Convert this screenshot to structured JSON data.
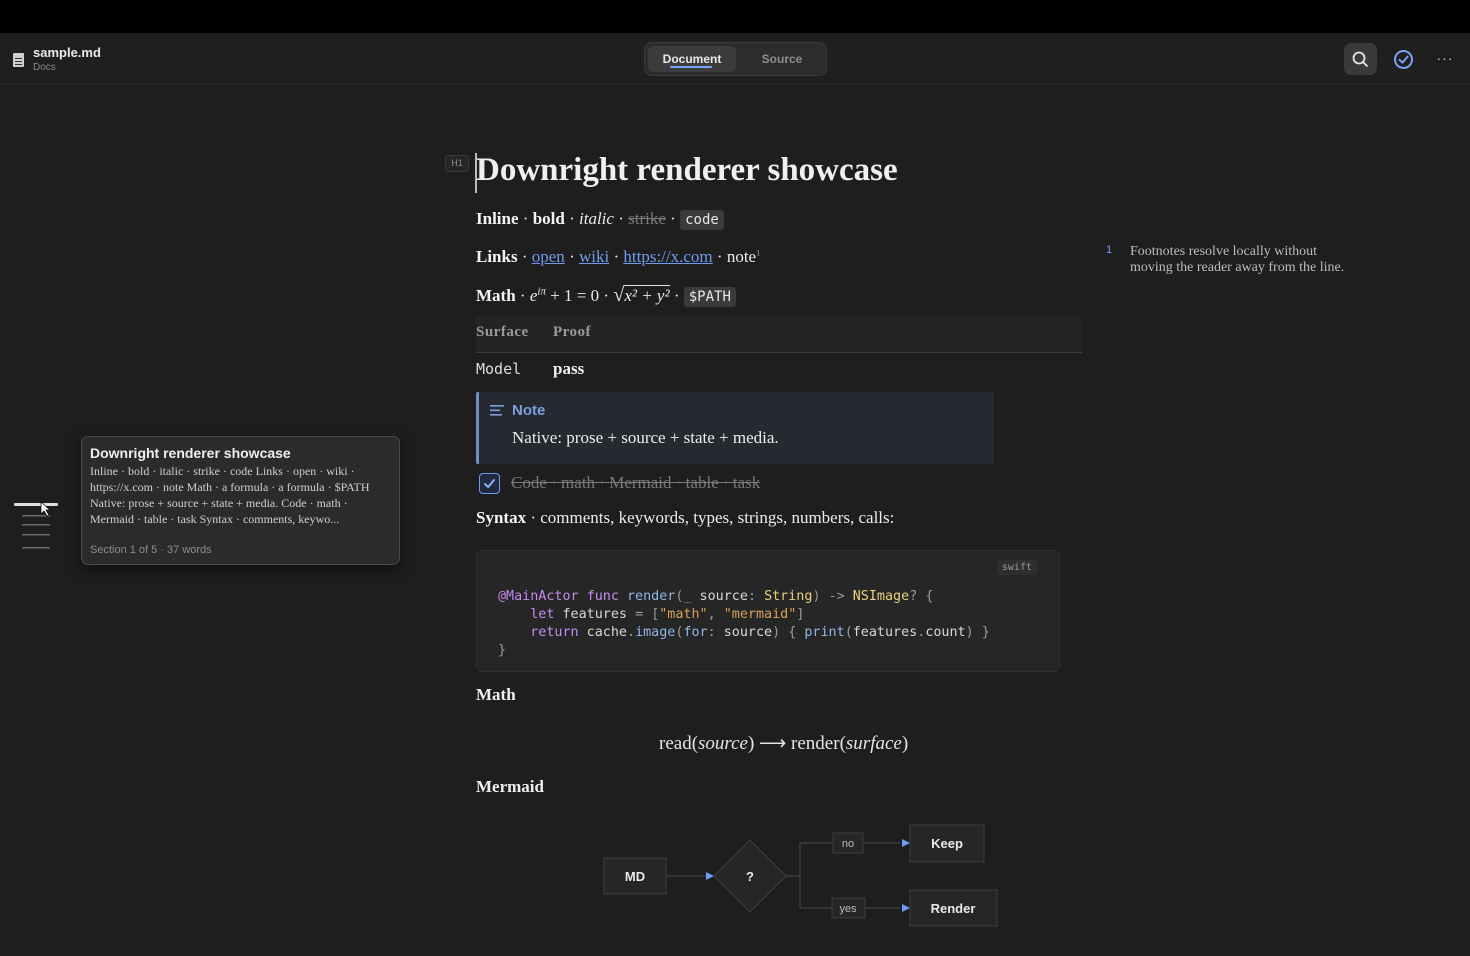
{
  "toolbar": {
    "file_name": "sample.md",
    "folder": "Docs",
    "mode_document": "Document",
    "mode_source": "Source",
    "more": "···"
  },
  "doc": {
    "heading_badge": "H1",
    "title": "Downright renderer showcase",
    "inline": {
      "label": "Inline",
      "bold": "bold",
      "italic": "italic",
      "strike": "strike",
      "code": "code",
      "sep": " · "
    },
    "links": {
      "label": "Links",
      "open": "open",
      "wiki": "wiki",
      "url": "https://x.com",
      "note": "note",
      "note_ref": "1"
    },
    "math_line": {
      "label": "Math",
      "formula1_a": "e",
      "formula1_sup": "iπ",
      "formula1_b": " + 1 = 0",
      "formula2_a": "√",
      "formula2_b": "x² + y²",
      "var": "$PATH"
    },
    "table": {
      "headers": [
        "Surface",
        "Proof"
      ],
      "rows": [
        [
          "Model",
          "pass"
        ]
      ]
    },
    "callout": {
      "title": "Note",
      "body": "Native: prose + source + state + media."
    },
    "task": {
      "text": "Code · math · Mermaid · table · task",
      "checked": true
    },
    "syntax": {
      "label": "Syntax",
      "text": " · comments, keywords, types, strings, numbers, calls:"
    },
    "code_block": {
      "language": "swift"
    },
    "math_heading": "Math",
    "math_block": {
      "a": "read(",
      "b": "source",
      "c": ") ⟶ render(",
      "d": "surface",
      "e": ")"
    },
    "mermaid_heading": "Mermaid",
    "mermaid": {
      "start": "MD",
      "decision": "?",
      "no_label": "no",
      "yes_label": "yes",
      "keep": "Keep",
      "render": "Render"
    }
  },
  "footnote": {
    "number": "1",
    "text": "Footnotes resolve locally without moving the reader away from the line."
  },
  "tooltip": {
    "title": "Downright renderer showcase",
    "body": "Inline · bold · italic · strike · code Links · open · wiki · https://x.com · note Math · a formula · a formula · $PATH Native: prose + source + state + media. Code · math · Mermaid · table · task Syntax · comments, keywo...",
    "meta": "Section 1 of 5 · 37 words"
  },
  "colors": {
    "accent": "#7aa2f7",
    "background": "#1e1e1e",
    "link": "#6f9cf0"
  }
}
